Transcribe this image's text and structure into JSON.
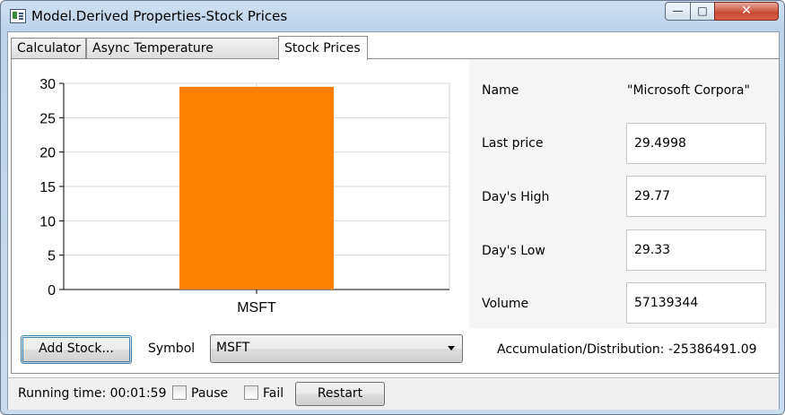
{
  "window": {
    "title": "Model.Derived Properties-Stock Prices",
    "icon": "app-window-icon",
    "buttons": {
      "minimize": "—",
      "maximize": "□",
      "close": "✕"
    }
  },
  "tabs": [
    {
      "label": "Calculator",
      "selected": false
    },
    {
      "label": "Async Temperature Converter",
      "selected": false
    },
    {
      "label": "Stock Prices",
      "selected": true
    }
  ],
  "chart_data": {
    "type": "bar",
    "categories": [
      "MSFT"
    ],
    "values": [
      29.4998
    ],
    "ylim": [
      0,
      30
    ],
    "yticks": [
      "0",
      "5",
      "10",
      "15",
      "20",
      "25",
      "30"
    ],
    "grid": true,
    "bar_color": "#ff8000"
  },
  "properties": {
    "name_label": "Name",
    "name_value": "\"Microsoft Corpora\"",
    "last_price_label": "Last price",
    "last_price_value": "29.4998",
    "days_high_label": "Day's High",
    "days_high_value": "29.77",
    "days_low_label": "Day's Low",
    "days_low_value": "29.33",
    "volume_label": "Volume",
    "volume_value": "57139344"
  },
  "controls": {
    "add_stock_label": "Add Stock...",
    "symbol_label": "Symbol",
    "symbol_value": "MSFT",
    "accumulation_text": "Accumulation/Distribution: -25386491.09"
  },
  "status": {
    "running_time": "Running time: 00:01:59",
    "pause_label": "Pause",
    "fail_label": "Fail",
    "restart_label": "Restart"
  }
}
